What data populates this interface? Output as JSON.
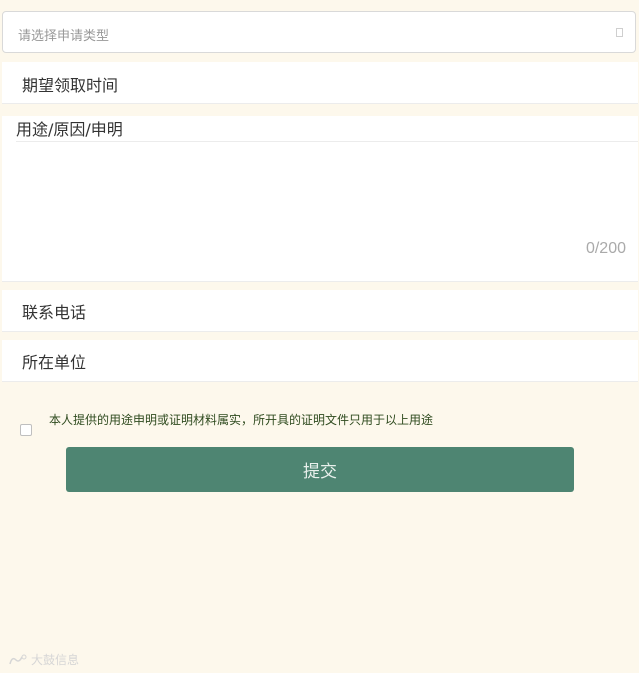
{
  "form": {
    "type_select": {
      "placeholder": "请选择申请类型"
    },
    "time_label": "期望领取时间",
    "reason": {
      "label": "用途/原因/申明",
      "value": "",
      "counter": "0/200"
    },
    "phone_label": "联系电话",
    "unit_label": "所在单位",
    "agreement_text": "本人提供的用途申明或证明材料属实，所开具的证明文件只用于以上用途",
    "agreement_checked": false,
    "submit_label": "提交"
  },
  "watermark": {
    "text": "大鼓信息"
  },
  "colors": {
    "background": "#fdf8ec",
    "submit": "#4e8572",
    "agreement_text": "#2f4b1f",
    "counter": "#aaaaaa"
  }
}
